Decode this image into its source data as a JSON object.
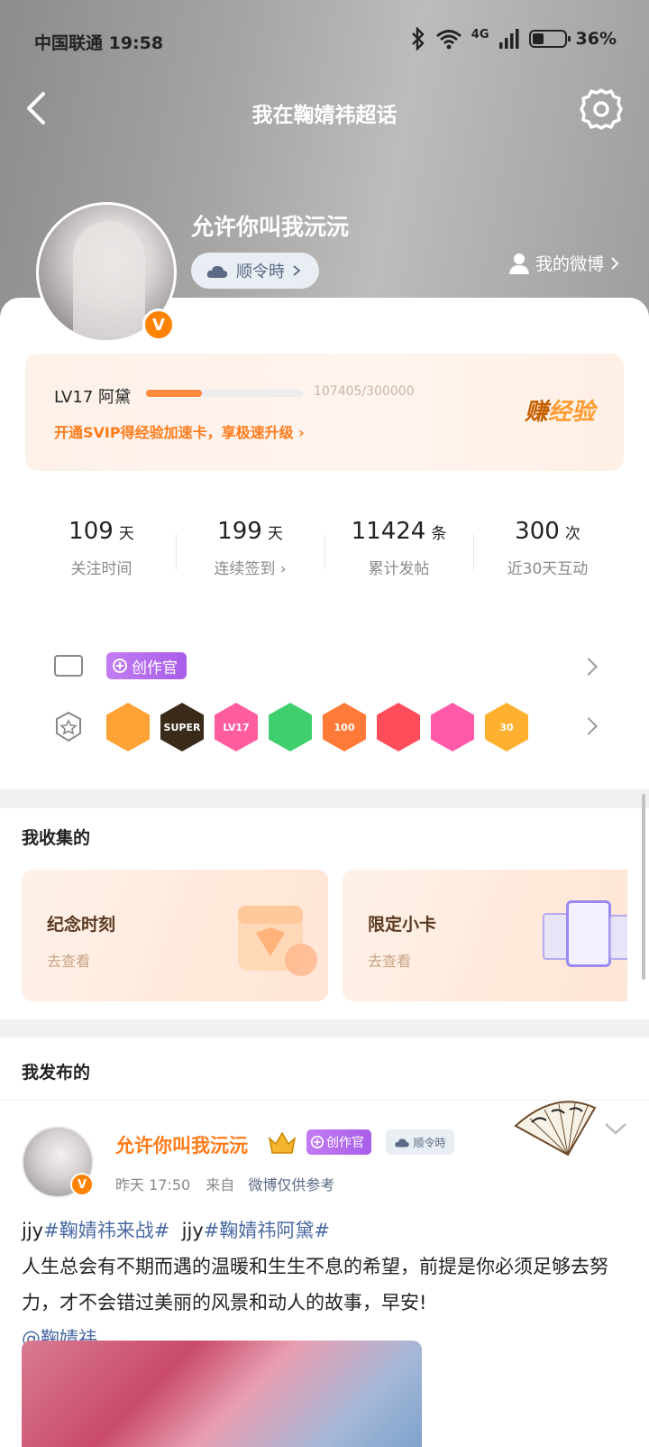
{
  "status_bar": {
    "carrier_time": "中国联通 19:58",
    "network": "4G",
    "battery": "36%"
  },
  "nav": {
    "title": "我在鞠婧祎超话"
  },
  "profile": {
    "username": "允许你叫我沅沅",
    "title_chip": "顺令時",
    "my_weibo": "我的微博"
  },
  "level": {
    "name": "LV17 阿黛",
    "exp_text": "107405/300000",
    "progress": 0.358,
    "tip": "开通SVIP得经验加速卡，享极速升级",
    "earn_label_a": "赚",
    "earn_label_b": "经验"
  },
  "stats": [
    {
      "num": "109",
      "unit": "天",
      "label": "关注时间"
    },
    {
      "num": "199",
      "unit": "天",
      "label": "连续签到"
    },
    {
      "num": "11424",
      "unit": "条",
      "label": "累计发帖"
    },
    {
      "num": "300",
      "unit": "次",
      "label": "近30天互动"
    }
  ],
  "badges": {
    "creator_label": "创作官",
    "medals": [
      {
        "name": "crown-medal",
        "color": "#ffa235",
        "text": ""
      },
      {
        "name": "super-medal",
        "color": "#3a2a1a",
        "text": "SUPER"
      },
      {
        "name": "lv17-medal",
        "color": "#ff5d9e",
        "text": "LV17"
      },
      {
        "name": "hand-medal",
        "color": "#3fcf6f",
        "text": ""
      },
      {
        "name": "100-days-medal",
        "color": "#ff7a38",
        "text": "100"
      },
      {
        "name": "trophy-medal",
        "color": "#ff4d5c",
        "text": ""
      },
      {
        "name": "graduate-medal",
        "color": "#ff5aa8",
        "text": ""
      },
      {
        "name": "30-days-medal",
        "color": "#ffb02e",
        "text": "30"
      }
    ]
  },
  "collection": {
    "title": "我收集的",
    "cards": [
      {
        "title": "纪念时刻",
        "sub": "去查看"
      },
      {
        "title": "限定小卡",
        "sub": "去查看"
      }
    ]
  },
  "posted": {
    "title": "我发布的",
    "post": {
      "author": "允许你叫我沅沅",
      "creator_label": "创作官",
      "title_chip": "顺令時",
      "time": "昨天 17:50",
      "from_label": "来自",
      "source": "微博仅供参考",
      "line1_prefix1": "jjy",
      "topic1": "#鞠婧祎来战#",
      "line1_prefix2": "jjy",
      "topic2": "#鞠婧祎阿黛#",
      "body": "人生总会有不期而遇的温暖和生生不息的希望，前提是你必须足够去努力，才不会错过美丽的风景和动人的故事，早安!",
      "mention": "@鞠婧祎"
    }
  }
}
